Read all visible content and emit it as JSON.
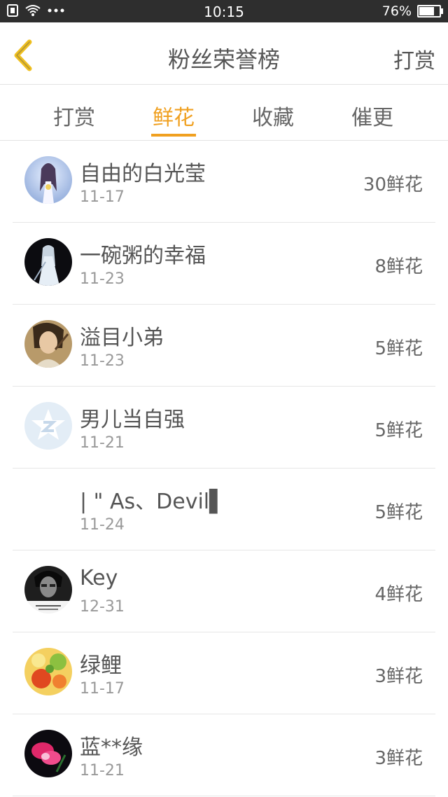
{
  "status_bar": {
    "time": "10:15",
    "battery_percent": "76%",
    "battery_level": 0.76
  },
  "header": {
    "title": "粉丝荣誉榜",
    "right_action": "打赏",
    "back_icon": "chevron-left-icon"
  },
  "tabs": [
    {
      "label": "打赏",
      "active": false
    },
    {
      "label": "鲜花",
      "active": true
    },
    {
      "label": "收藏",
      "active": false
    },
    {
      "label": "催更",
      "active": false
    }
  ],
  "accent_color": "#f0a020",
  "list": [
    {
      "name": "自由的白光莹",
      "date": "11-17",
      "amount": "30鲜花",
      "avatar": "female-figure-avatar"
    },
    {
      "name": "一碗粥的幸福",
      "date": "11-23",
      "amount": "8鲜花",
      "avatar": "white-robe-figure-avatar"
    },
    {
      "name": "溢目小弟",
      "date": "11-23",
      "amount": "5鲜花",
      "avatar": "portrait-avatar"
    },
    {
      "name": "男儿当自强",
      "date": "11-21",
      "amount": "5鲜花",
      "avatar": "default-qzone-avatar"
    },
    {
      "name": "| \" As、Devil▌",
      "date": "11-24",
      "amount": "5鲜花",
      "avatar": "empty-avatar"
    },
    {
      "name": "Key",
      "date": "12-31",
      "amount": "4鲜花",
      "avatar": "bw-portrait-avatar"
    },
    {
      "name": "绿鲤",
      "date": "11-17",
      "amount": "3鲜花",
      "avatar": "flower-painting-avatar"
    },
    {
      "name": "蓝**缘",
      "date": "11-21",
      "amount": "3鲜花",
      "avatar": "pink-flower-avatar"
    }
  ]
}
